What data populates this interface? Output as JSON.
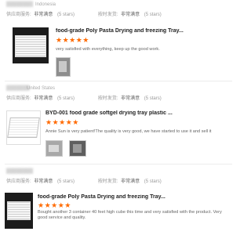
{
  "reviews": [
    {
      "country": "Indonesia",
      "supplier_service_label": "供应商服务:",
      "supplier_service_value": "非常满意",
      "supplier_service_stars": "(5 stars)",
      "delivery_label": "按时发货:",
      "delivery_value": "非常满意",
      "delivery_stars": "(5 stars)",
      "product_title": "food-grade Poly Pasta Drying and freezing Tray...",
      "rating_stars": "★★★★★",
      "review_text": "very satisfied with everything, keep up the good work."
    },
    {
      "country": "United States",
      "supplier_service_label": "供应商服务:",
      "supplier_service_value": "非常满意",
      "supplier_service_stars": "(5 stars)",
      "delivery_label": "按时发货:",
      "delivery_value": "非常满意",
      "delivery_stars": "(5 stars)",
      "product_title": "BYD-001 food grade softgel drying tray plastic ...",
      "rating_stars": "★★★★★",
      "review_text": "Annie Sun is very patient!The quality is very good, we have started to use it and sell it"
    },
    {
      "country": "",
      "supplier_service_label": "供应商服务:",
      "supplier_service_value": "非常满意",
      "supplier_service_stars": "(5 stars)",
      "delivery_label": "按时发货:",
      "delivery_value": "非常满意",
      "delivery_stars": "(5 stars)",
      "product_title": "food-grade Poly Pasta Drying and freezing Tray...",
      "rating_stars": "★★★★★",
      "review_text": "Bought another 3 container 40 feet high cube this time and very satisfied with the product. Very good service and quality."
    }
  ],
  "colors": {
    "accent": "#ff6a00",
    "title": "#222222",
    "meta": "#999999"
  }
}
